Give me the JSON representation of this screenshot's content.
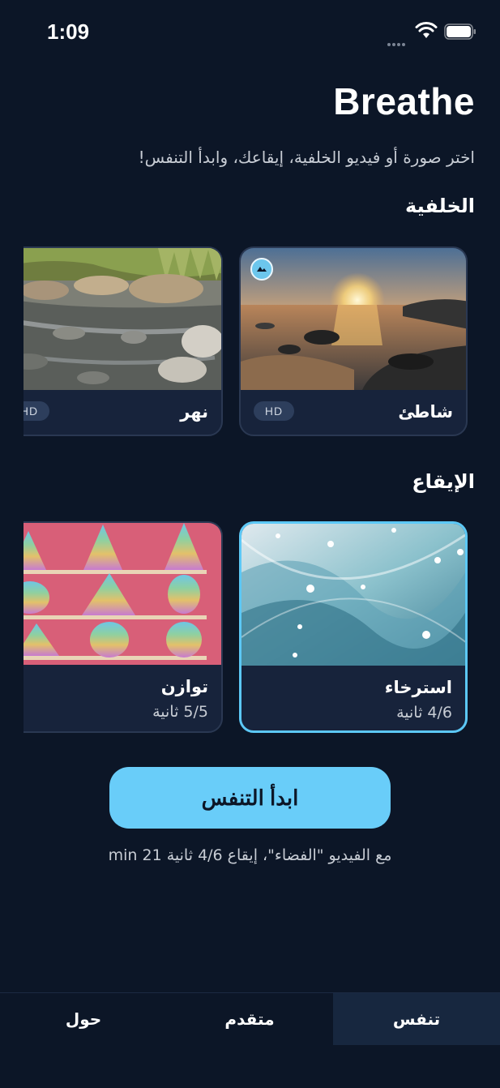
{
  "status": {
    "time": "1:09"
  },
  "app": {
    "title": "Breathe",
    "subtitle": "اختر صورة أو فيديو الخلفية، إيقاعك، وابدأ التنفس!"
  },
  "background_section": {
    "title": "الخلفية",
    "items": [
      {
        "name": "شاطئ",
        "badge": "HD",
        "icon": "pulse-icon"
      },
      {
        "name": "نهر",
        "badge": "HD"
      }
    ]
  },
  "rhythm_section": {
    "title": "الإيقاع",
    "items": [
      {
        "name": "استرخاء",
        "subtitle": "4/6 ثانية",
        "selected": true
      },
      {
        "name": "توازن",
        "subtitle": "5/5 ثانية",
        "selected": false
      }
    ]
  },
  "start_button": {
    "label": "ابدأ التنفس"
  },
  "summary": "مع الفيديو \"الفضاء\"، إيقاع 4/6 ثانية 21 min",
  "tabs": [
    {
      "label": "تنفس",
      "active": true
    },
    {
      "label": "متقدم",
      "active": false
    },
    {
      "label": "حول",
      "active": false
    }
  ],
  "colors": {
    "background": "#0c1627",
    "accent": "#69cdf9",
    "card": "#17233b"
  }
}
